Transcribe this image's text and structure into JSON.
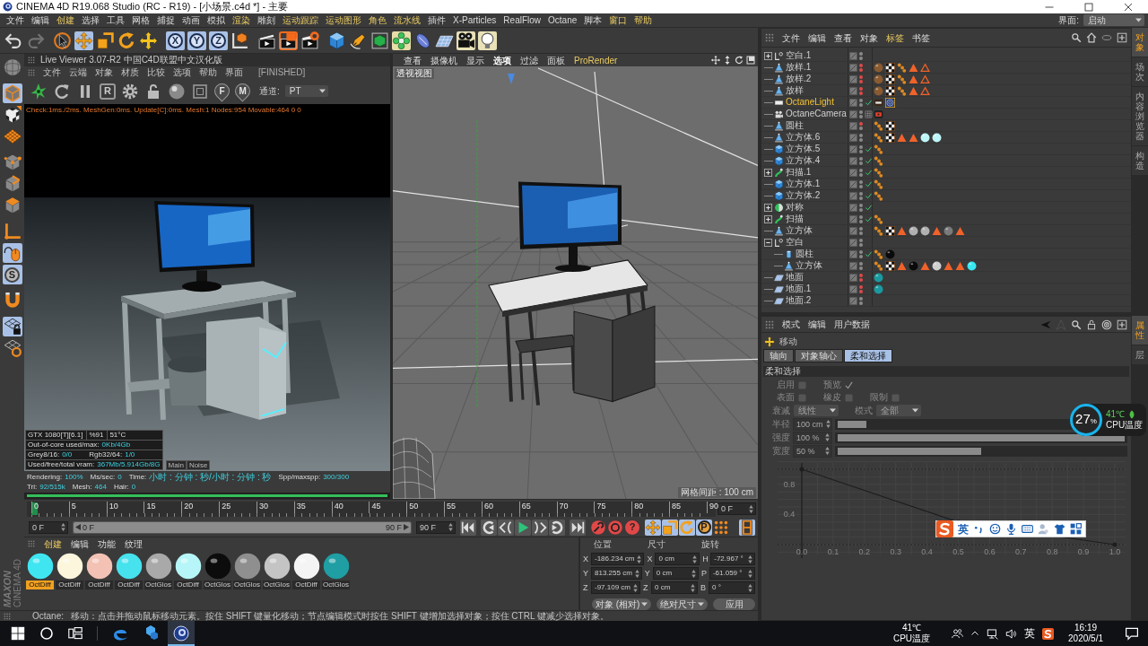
{
  "window": {
    "title": "CINEMA 4D R19.068 Studio (RC - R19) - [小场景.c4d *] - 主要"
  },
  "menu": [
    {
      "label": "文件",
      "highlighted": false
    },
    {
      "label": "编辑",
      "highlighted": false
    },
    {
      "label": "创建",
      "highlighted": true
    },
    {
      "label": "选择",
      "highlighted": false
    },
    {
      "label": "工具",
      "highlighted": false
    },
    {
      "label": "网格",
      "highlighted": false
    },
    {
      "label": "捕捉",
      "highlighted": false
    },
    {
      "label": "动画",
      "highlighted": false
    },
    {
      "label": "模拟",
      "highlighted": false
    },
    {
      "label": "渲染",
      "highlighted": true
    },
    {
      "label": "雕刻",
      "highlighted": false
    },
    {
      "label": "运动跟踪",
      "highlighted": true
    },
    {
      "label": "运动图形",
      "highlighted": true
    },
    {
      "label": "角色",
      "highlighted": true
    },
    {
      "label": "流水线",
      "highlighted": true
    },
    {
      "label": "插件",
      "highlighted": false
    },
    {
      "label": "X-Particles",
      "highlighted": false
    },
    {
      "label": "RealFlow",
      "highlighted": false
    },
    {
      "label": "Octane",
      "highlighted": false
    },
    {
      "label": "脚本",
      "highlighted": false
    },
    {
      "label": "窗口",
      "highlighted": true
    },
    {
      "label": "帮助",
      "highlighted": true
    }
  ],
  "layout_selector": {
    "label": "界面:",
    "value": "启动"
  },
  "main_toolbar": [
    {
      "on": false,
      "disabled": false
    },
    {
      "on": false,
      "disabled": true
    },
    {
      "on": false,
      "disabled": false
    },
    {
      "on": true,
      "disabled": false
    },
    {
      "on": false,
      "disabled": false
    },
    {
      "on": false,
      "disabled": false
    },
    {
      "on": false,
      "disabled": false
    },
    {
      "label": "X",
      "on": true,
      "disabled": false
    },
    {
      "label": "Y",
      "on": true,
      "disabled": false
    },
    {
      "label": "Z",
      "on": true,
      "disabled": false
    },
    {
      "on": false,
      "disabled": false
    },
    {
      "on": false,
      "disabled": false
    },
    {
      "on": true,
      "disabled": false
    },
    {
      "on": false,
      "disabled": false
    },
    {
      "on": false,
      "disabled": false
    },
    {
      "on": false,
      "disabled": false
    },
    {
      "on": false,
      "disabled": false
    },
    {
      "on": true,
      "disabled": false
    },
    {
      "on": false,
      "disabled": false
    },
    {
      "on": false,
      "disabled": false
    },
    {
      "on": true,
      "disabled": false
    },
    {
      "on": true,
      "disabled": false
    }
  ],
  "left_toolbar": [
    {
      "on": false
    },
    {
      "on": true
    },
    {
      "on": false
    },
    {
      "on": false
    },
    {
      "on": false
    },
    {
      "on": false
    },
    {
      "on": false
    },
    {
      "on": false
    },
    {
      "on": true
    },
    {
      "label": "S",
      "on": true
    },
    {
      "on": false
    },
    {
      "on": true
    },
    {
      "on": false
    }
  ],
  "live_viewer": {
    "title": "Live Viewer 3.07-R2 中国C4D联盟中文汉化版",
    "menu": [
      "文件",
      "云端",
      "对象",
      "材质",
      "比较",
      "选项",
      "帮助",
      "界面"
    ],
    "state": "[FINISHED]",
    "tool_labels": [
      "R",
      "F",
      "M"
    ],
    "channel": {
      "label": "通道:",
      "value": "PT"
    },
    "log": "Check:1ms./2ms. MeshGen:0ms. Update[C]:0ms. Mesh:1 Nodes:954 Movable:464 0 0",
    "gpu": [
      "GTX 1080[T][6.1]",
      "%91",
      "51°C"
    ],
    "stats": [
      [
        {
          "label": "Out-of-core used/max:",
          "value": "0Kb/4Gb"
        }
      ],
      [
        {
          "label": "Grey8/16:",
          "value": "0/0"
        },
        {
          "label": "Rgb32/64:",
          "value": "1/0"
        }
      ],
      [
        {
          "label": "Used/free/total vram:",
          "value": "367Mb/5.914Gb/8G"
        }
      ]
    ],
    "passes": [
      "Main",
      "Noise"
    ],
    "render_stats": [
      {
        "label": "Rendering:",
        "value": "100%"
      },
      {
        "label": "Ms/sec:",
        "value": "0"
      },
      {
        "label": "Time:",
        "value": "小时 : 分钟 : 秒/小时 : 分钟 : 秒"
      },
      {
        "label": "Spp/maxspp:",
        "value": "300/300"
      },
      {
        "label": "Tri:",
        "value": "92/515k"
      },
      {
        "label": "Mesh:",
        "value": "464"
      },
      {
        "label": "Hair:",
        "value": "0"
      }
    ],
    "progress": {
      "level": 1
    }
  },
  "viewport": {
    "menu": [
      {
        "label": "查看",
        "highlighted": false,
        "selected": false
      },
      {
        "label": "摄像机",
        "highlighted": false,
        "selected": false
      },
      {
        "label": "显示",
        "highlighted": false,
        "selected": false
      },
      {
        "label": "选项",
        "highlighted": false,
        "selected": true
      },
      {
        "label": "过滤",
        "highlighted": false,
        "selected": false
      },
      {
        "label": "面板",
        "highlighted": false,
        "selected": false
      },
      {
        "label": "ProRender",
        "highlighted": true,
        "selected": false
      }
    ],
    "view_name": "透视视图",
    "grid_spacing": "网格间距 : 100 cm"
  },
  "timeline": {
    "ticks": [
      "0",
      "5",
      "10",
      "15",
      "20",
      "25",
      "30",
      "35",
      "40",
      "45",
      "50",
      "55",
      "60",
      "65",
      "70",
      "75",
      "80",
      "85",
      "90"
    ],
    "playhead": {
      "level": 0
    },
    "current": "0 F"
  },
  "playback": {
    "start": "0 F",
    "range": {
      "level": 1
    },
    "range_start": "0 F",
    "range_end": "90 F",
    "end": "90 F",
    "record_mark": "?",
    "key_toggles": [
      {
        "on": true
      },
      {
        "on": true
      },
      {
        "on": true
      },
      {
        "label": "P",
        "on": true
      },
      {
        "on": false
      },
      {
        "on": true
      }
    ]
  },
  "brand": {
    "maker": "MAXON",
    "product": "CINEMA 4D"
  },
  "materials": {
    "menu": [
      {
        "label": "创建",
        "highlighted": true
      },
      {
        "label": "编辑",
        "highlighted": false
      },
      {
        "label": "功能",
        "highlighted": false
      },
      {
        "label": "纹理",
        "highlighted": false
      }
    ],
    "items": [
      {
        "name": "OctDiff",
        "color": "#3fe6f2",
        "selected": true
      },
      {
        "name": "OctDiff",
        "color": "#fbf6dc",
        "selected": false
      },
      {
        "name": "OctDiff",
        "color": "#f3c2b4",
        "selected": false
      },
      {
        "name": "OctDiff",
        "color": "#46e2ee",
        "selected": false
      },
      {
        "name": "OctGlos",
        "color": "#a9a9a9",
        "selected": false
      },
      {
        "name": "OctDiff",
        "color": "#b7f6f8",
        "selected": false
      },
      {
        "name": "OctGlos",
        "color": "#0c0c0c",
        "selected": false
      },
      {
        "name": "OctGlos",
        "color": "#8f8f8f",
        "selected": false
      },
      {
        "name": "OctGlos",
        "color": "#c4c4c4",
        "selected": false
      },
      {
        "name": "OctDiff",
        "color": "#f4f4f4",
        "selected": false
      },
      {
        "name": "OctGlos",
        "color": "#1f9ea3",
        "selected": false
      }
    ]
  },
  "coordinates": {
    "headers": [
      "位置",
      "尺寸",
      "旋转"
    ],
    "rows": [
      [
        {
          "axis": "X",
          "value": "-186.234 cm"
        },
        {
          "axis": "X",
          "value": "0 cm"
        },
        {
          "axis": "H",
          "value": "-72.967 °"
        }
      ],
      [
        {
          "axis": "Y",
          "value": "813.255 cm"
        },
        {
          "axis": "Y",
          "value": "0 cm"
        },
        {
          "axis": "P",
          "value": "-61.059 °"
        }
      ],
      [
        {
          "axis": "Z",
          "value": "-97.109 cm"
        },
        {
          "axis": "Z",
          "value": "0 cm"
        },
        {
          "axis": "B",
          "value": "0 °"
        }
      ]
    ],
    "modes": [
      "对象 (相对)",
      "绝对尺寸"
    ],
    "apply": "应用"
  },
  "status_bar": {
    "label": "Octane:",
    "message": "移动：点击并拖动鼠标移动元素。按住 SHIFT 键量化移动；节点编辑模式时按住 SHIFT 键增加选择对象；按住 CTRL 键减少选择对象。"
  },
  "object_manager": {
    "menu": [
      {
        "label": "文件",
        "highlighted": false
      },
      {
        "label": "编辑",
        "highlighted": false
      },
      {
        "label": "查看",
        "highlighted": false
      },
      {
        "label": "对象",
        "highlighted": false
      },
      {
        "label": "标签",
        "highlighted": true
      },
      {
        "label": "书签",
        "highlighted": false
      }
    ],
    "objects": [
      {
        "name": "空白.1",
        "kind": "null",
        "expanded": false,
        "selected": false,
        "editor_off": false,
        "render_off": false
      },
      {
        "name": "放样.1",
        "kind": "polygon",
        "selected": false,
        "editor_off": true,
        "render_off": true,
        "tags": [
          {
            "kind": "material",
            "color": "#8a5a30",
            "selected": false
          },
          {
            "kind": "texture",
            "selected": false
          },
          {
            "kind": "phong",
            "selected": false
          },
          {
            "kind": "selection",
            "selected": false
          },
          {
            "kind": "edge_selection",
            "selected": false
          }
        ]
      },
      {
        "name": "放样.2",
        "kind": "polygon",
        "selected": false,
        "editor_off": true,
        "render_off": true,
        "tags": [
          {
            "kind": "material",
            "color": "#8a5a30",
            "selected": false
          },
          {
            "kind": "texture",
            "selected": false
          },
          {
            "kind": "phong",
            "selected": false
          },
          {
            "kind": "selection",
            "selected": false
          },
          {
            "kind": "edge_selection",
            "selected": false
          }
        ]
      },
      {
        "name": "放样",
        "kind": "polygon",
        "selected": false,
        "editor_off": true,
        "render_off": true,
        "tags": [
          {
            "kind": "material",
            "color": "#8a5a30",
            "selected": false
          },
          {
            "kind": "texture",
            "selected": false
          },
          {
            "kind": "phong",
            "selected": false
          },
          {
            "kind": "selection",
            "selected": false
          },
          {
            "kind": "edge_selection",
            "selected": false
          }
        ]
      },
      {
        "name": "OctaneLight",
        "kind": "light",
        "selected": true,
        "editor_off": false,
        "render_off": false,
        "state_mark": {
          "kind": "check"
        },
        "tags": [
          {
            "kind": "light_tag",
            "selected": false
          },
          {
            "kind": "target",
            "selected": true
          }
        ]
      },
      {
        "name": "OctaneCamera",
        "kind": "camera",
        "selected": false,
        "editor_off": false,
        "render_off": false,
        "state_mark": {
          "kind": "grid"
        },
        "tags": [
          {
            "kind": "camera_tag",
            "selected": false
          }
        ]
      },
      {
        "name": "圆柱",
        "kind": "polygon",
        "selected": false,
        "editor_off": true,
        "render_off": false,
        "tags": [
          {
            "kind": "phong",
            "selected": false
          },
          {
            "kind": "texture",
            "selected": false
          }
        ]
      },
      {
        "name": "立方体.6",
        "kind": "polygon",
        "selected": false,
        "editor_off": false,
        "render_off": false,
        "tags": [
          {
            "kind": "phong",
            "selected": false
          },
          {
            "kind": "texture",
            "selected": false
          },
          {
            "kind": "selection",
            "selected": false
          },
          {
            "kind": "selection",
            "selected": false
          },
          {
            "kind": "material",
            "color": "#bff6f8",
            "selected": false
          },
          {
            "kind": "material",
            "color": "#bff6f8",
            "selected": false
          }
        ]
      },
      {
        "name": "立方体.5",
        "kind": "cube",
        "selected": false,
        "editor_off": false,
        "render_off": false,
        "state_mark": {
          "kind": "check"
        },
        "tags": [
          {
            "kind": "phong",
            "selected": false
          }
        ]
      },
      {
        "name": "立方体.4",
        "kind": "cube",
        "selected": false,
        "editor_off": false,
        "render_off": false,
        "state_mark": {
          "kind": "check"
        },
        "tags": [
          {
            "kind": "phong",
            "selected": false
          }
        ]
      },
      {
        "name": "扫描.1",
        "kind": "sweep",
        "expanded": false,
        "selected": false,
        "editor_off": false,
        "render_off": false,
        "state_mark": {
          "kind": "check"
        },
        "tags": [
          {
            "kind": "phong",
            "selected": false
          }
        ]
      },
      {
        "name": "立方体.1",
        "kind": "cube",
        "selected": false,
        "editor_off": false,
        "render_off": false,
        "state_mark": {
          "kind": "check"
        },
        "tags": [
          {
            "kind": "phong",
            "selected": false
          }
        ]
      },
      {
        "name": "立方体.2",
        "kind": "cube",
        "selected": false,
        "editor_off": false,
        "render_off": false,
        "state_mark": {
          "kind": "check"
        },
        "tags": [
          {
            "kind": "phong",
            "selected": false
          }
        ]
      },
      {
        "name": "对称",
        "kind": "symmetry",
        "expanded": false,
        "selected": false,
        "editor_off": false,
        "render_off": false,
        "state_mark": {
          "kind": "check"
        }
      },
      {
        "name": "扫描",
        "kind": "sweep",
        "expanded": false,
        "selected": false,
        "editor_off": false,
        "render_off": false,
        "state_mark": {
          "kind": "check"
        },
        "tags": [
          {
            "kind": "phong",
            "selected": false
          }
        ]
      },
      {
        "name": "立方体",
        "kind": "polygon",
        "selected": false,
        "editor_off": false,
        "render_off": false,
        "tags": [
          {
            "kind": "phong",
            "selected": false
          },
          {
            "kind": "texture",
            "selected": false
          },
          {
            "kind": "selection",
            "selected": false
          },
          {
            "kind": "material",
            "color": "#b0b0b0",
            "selected": false
          },
          {
            "kind": "material",
            "color": "#b0b0b0",
            "selected": false
          },
          {
            "kind": "selection",
            "selected": false
          },
          {
            "kind": "material",
            "color": "#7a7a7a",
            "selected": false
          },
          {
            "kind": "selection",
            "selected": false
          }
        ]
      },
      {
        "name": "空白",
        "kind": "null",
        "expanded": true,
        "selected": false,
        "editor_off": false,
        "render_off": false,
        "children": [
          {
            "name": "圆柱",
            "kind": "cylinder",
            "selected": false,
            "editor_off": false,
            "render_off": false,
            "state_mark": {
              "kind": "check"
            },
            "tags": [
              {
                "kind": "phong",
                "selected": false
              },
              {
                "kind": "material",
                "color": "#0a0a0a",
                "selected": false
              }
            ]
          },
          {
            "name": "立方体",
            "kind": "polygon",
            "selected": false,
            "editor_off": false,
            "render_off": false,
            "tags": [
              {
                "kind": "phong",
                "selected": false
              },
              {
                "kind": "texture",
                "selected": false
              },
              {
                "kind": "selection",
                "selected": false
              },
              {
                "kind": "material",
                "color": "#0a0a0a",
                "selected": false
              },
              {
                "kind": "selection",
                "selected": false
              },
              {
                "kind": "material",
                "color": "#d0d0d0",
                "selected": false
              },
              {
                "kind": "selection",
                "selected": false
              },
              {
                "kind": "selection",
                "selected": false
              },
              {
                "kind": "material",
                "color": "#38e8f2",
                "selected": false
              }
            ]
          }
        ]
      },
      {
        "name": "地面",
        "kind": "floor",
        "selected": false,
        "editor_off": true,
        "render_off": true,
        "tags": [
          {
            "kind": "material",
            "color": "#1a9aa0",
            "selected": false
          }
        ]
      },
      {
        "name": "地面.1",
        "kind": "floor",
        "selected": false,
        "editor_off": true,
        "render_off": true,
        "tags": [
          {
            "kind": "material",
            "color": "#1a9aa0",
            "selected": false
          }
        ]
      },
      {
        "name": "地面.2",
        "kind": "floor",
        "selected": false,
        "editor_off": false,
        "render_off": false
      }
    ]
  },
  "side_tabs_top": [
    {
      "label": "对象",
      "selected": true
    },
    {
      "label": "场次",
      "selected": false
    },
    {
      "label": "内容浏览器",
      "selected": false
    },
    {
      "label": "构造",
      "selected": false
    }
  ],
  "attribute_manager": {
    "menu": [
      "模式",
      "编辑",
      "用户数据"
    ],
    "tool": "移动",
    "tabs": [
      {
        "label": "轴向",
        "selected": false
      },
      {
        "label": "对象轴心",
        "selected": false
      },
      {
        "label": "柔和选择",
        "selected": true
      }
    ],
    "section": "柔和选择",
    "disabled": true,
    "checkbox_rows": [
      [
        {
          "label": "启用",
          "checked": false
        },
        {
          "label": "预览",
          "checked": true
        }
      ],
      [
        {
          "label": "表面",
          "checked": false
        },
        {
          "label": "橡皮",
          "checked": false
        },
        {
          "label": "限制",
          "checked": false
        }
      ]
    ],
    "dropdowns": [
      {
        "label": "衰减",
        "value": "线性"
      },
      {
        "label": "模式",
        "value": "全部"
      }
    ],
    "sliders": [
      {
        "label": "半径",
        "value": "100 cm",
        "level": 0.1
      },
      {
        "label": "强度",
        "value": "100 %",
        "level": 1
      },
      {
        "label": "宽度",
        "value": "50 %",
        "level": 0.5
      }
    ],
    "chart_data": {
      "type": "line",
      "x": [
        0,
        0.5,
        1
      ],
      "values": [
        1,
        0.3,
        0
      ],
      "xlim": [
        0,
        1
      ],
      "ylim": [
        0,
        1
      ],
      "grid": true,
      "xticks": [
        {
          "value": 0,
          "label": "0.0"
        },
        {
          "value": 0.1,
          "label": "0.1"
        },
        {
          "value": 0.2,
          "label": "0.2"
        },
        {
          "value": 0.3,
          "label": "0.3"
        },
        {
          "value": 0.4,
          "label": "0.4"
        },
        {
          "value": 0.5,
          "label": "0.5"
        },
        {
          "value": 0.6,
          "label": "0.6"
        },
        {
          "value": 0.7,
          "label": "0.7"
        },
        {
          "value": 0.8,
          "label": "0.8"
        },
        {
          "value": 0.9,
          "label": "0.9"
        },
        {
          "value": 1,
          "label": "1.0"
        }
      ],
      "yticks": [
        {
          "value": 0.4,
          "label": "0.4"
        },
        {
          "value": 0.8,
          "label": "0.8"
        }
      ]
    }
  },
  "side_tabs_bottom": [
    {
      "label": "属性",
      "selected": true
    },
    {
      "label": "层",
      "selected": false
    }
  ],
  "cpu_widget": {
    "load": "27",
    "unit": "%",
    "temperature": "41℃",
    "label": "CPU温度"
  },
  "ime_bar": {
    "mode": "英"
  },
  "taskbar": {
    "apps": [
      {
        "active": false
      },
      {
        "active": false
      },
      {
        "active": true
      }
    ],
    "temperature": "41℃",
    "temperature_label": "CPU温度",
    "ime": "英",
    "time": "16:19",
    "date": "2020/5/1"
  }
}
